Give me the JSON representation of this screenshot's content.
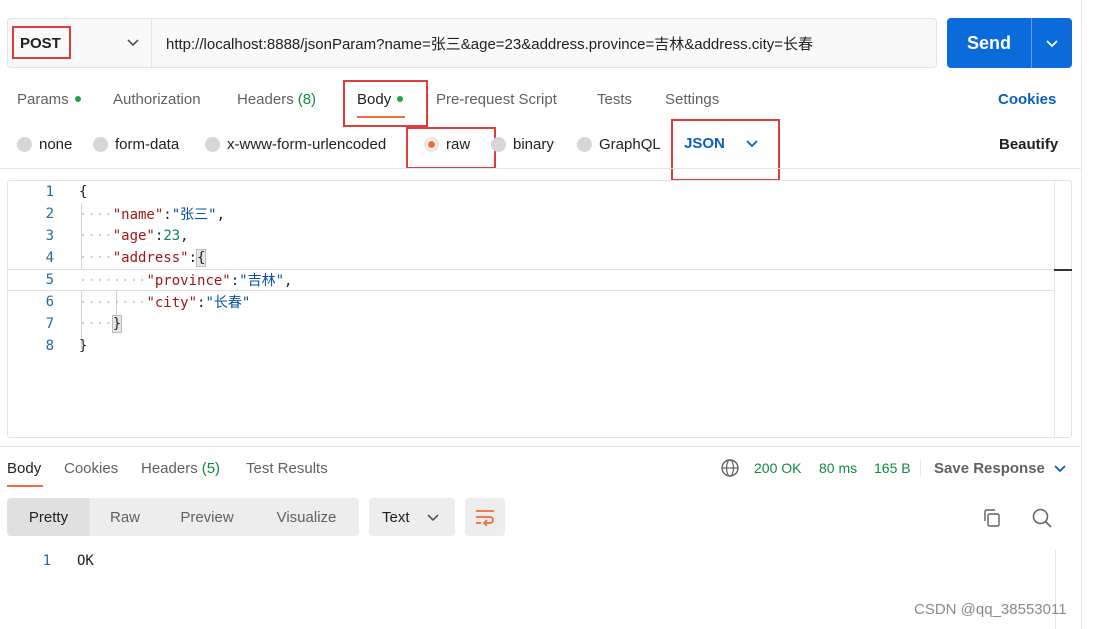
{
  "request": {
    "method": "POST",
    "url": "http://localhost:8888/jsonParam?name=张三&age=23&address.province=吉林&address.city=长春",
    "send_label": "Send"
  },
  "request_tabs": {
    "params": "Params",
    "authorization": "Authorization",
    "headers": "Headers",
    "headers_count": "(8)",
    "body": "Body",
    "prerequest": "Pre-request Script",
    "tests": "Tests",
    "settings": "Settings",
    "cookies": "Cookies"
  },
  "body_types": {
    "none": "none",
    "form_data": "form-data",
    "urlencoded": "x-www-form-urlencoded",
    "raw": "raw",
    "binary": "binary",
    "graphql": "GraphQL",
    "language": "JSON",
    "beautify": "Beautify",
    "selected": "raw"
  },
  "editor": {
    "line_numbers": [
      "1",
      "2",
      "3",
      "4",
      "5",
      "6",
      "7",
      "8"
    ],
    "tokens": {
      "open_brace": "{",
      "close_brace": "}",
      "name_key": "\"name\"",
      "name_val": "\"张三\"",
      "age_key": "\"age\"",
      "age_val": "23",
      "address_key": "\"address\"",
      "province_key": "\"province\"",
      "province_val": "\"吉林\"",
      "city_key": "\"city\"",
      "city_val": "\"长春\"",
      "colon": ":",
      "comma": ","
    }
  },
  "response_tabs": {
    "body": "Body",
    "cookies": "Cookies",
    "headers": "Headers",
    "headers_count": "(5)",
    "test_results": "Test Results"
  },
  "response_status": {
    "status": "200 OK",
    "time": "80 ms",
    "size": "165 B",
    "save_response": "Save Response"
  },
  "response_view": {
    "pretty": "Pretty",
    "raw": "Raw",
    "preview": "Preview",
    "visualize": "Visualize",
    "format": "Text",
    "line_number": "1",
    "body_text": "OK"
  },
  "watermark": "CSDN @qq_38553011",
  "colors": {
    "accent_orange": "#f26b3a",
    "send_blue": "#0b6bdb",
    "success_green": "#0e8a3c",
    "annotation_red": "#e03c3c"
  }
}
